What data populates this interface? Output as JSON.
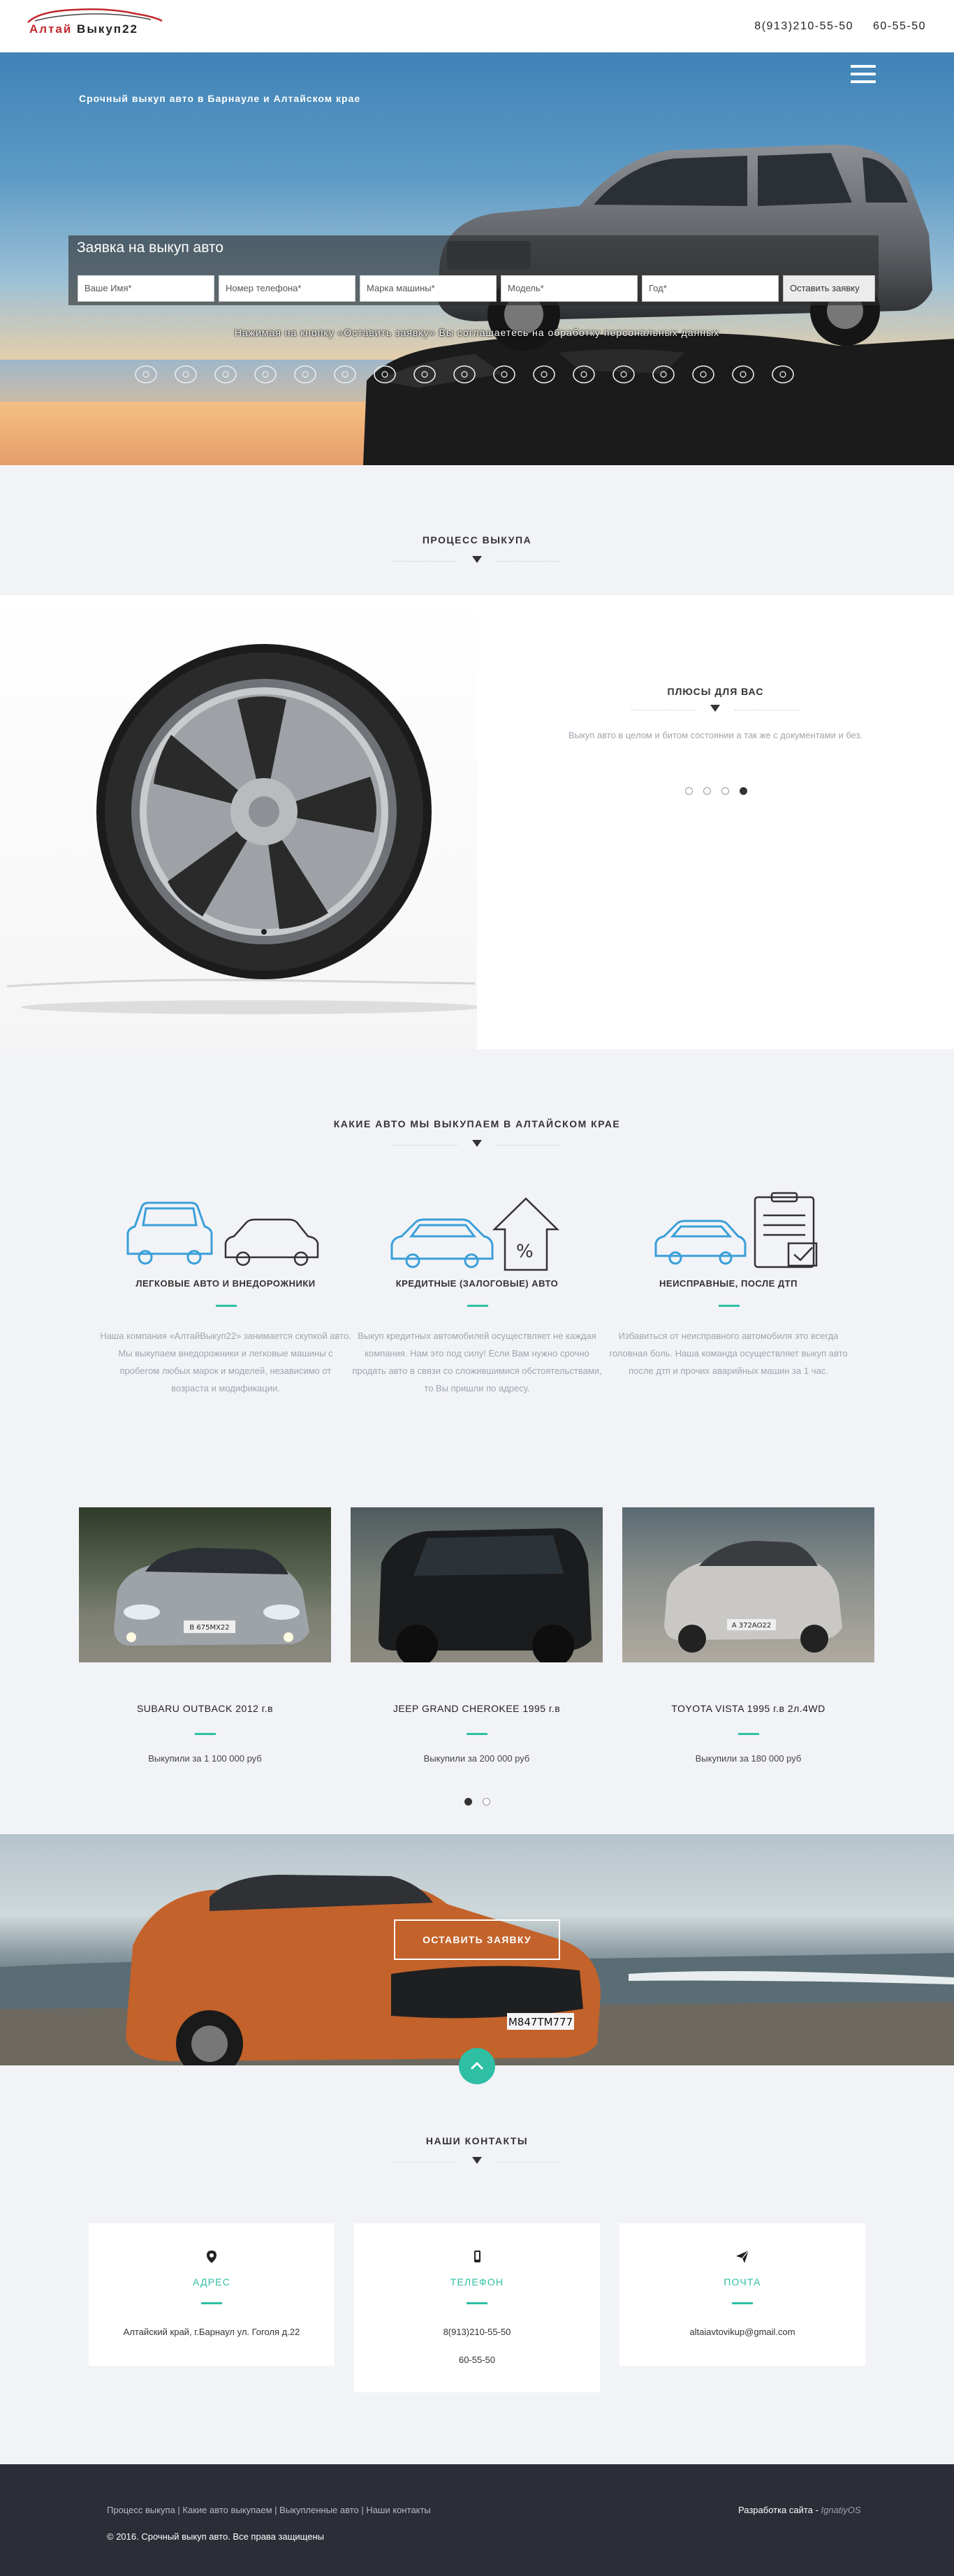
{
  "header": {
    "logo_part1": "Алтай",
    "logo_part2": "Выкуп22",
    "phone1": "8(913)210-55-50",
    "phone2": "60-55-50"
  },
  "hero": {
    "subtitle": "Срочный выкуп авто в Барнауле и Алтайском крае",
    "form_title": "Заявка на выкуп авто",
    "fields": [
      {
        "placeholder": "Ваше Имя*"
      },
      {
        "placeholder": "Номер телефона*"
      },
      {
        "placeholder": "Марка машины*"
      },
      {
        "placeholder": "Модель*"
      },
      {
        "placeholder": "Год*"
      }
    ],
    "submit_label": "Оставить заявку",
    "consent": "Нажимая на кнопку «Оставить заявку» Вы соглашаетесь на обработку персональных данных",
    "brands": [
      "mercedes-logo-icon",
      "chevrolet-logo-icon",
      "renault-logo-icon",
      "bmw-logo-icon",
      "audi-logo-icon",
      "opel-logo-icon",
      "ford-logo-icon",
      "skoda-logo-icon",
      "volkswagen-logo-icon",
      "nissan-logo-icon",
      "kia-logo-icon",
      "peugeot-logo-icon",
      "lexus-logo-icon",
      "hyundai-logo-icon",
      "citroen-logo-icon",
      "toyota-logo-icon",
      "mazda-logo-icon"
    ]
  },
  "process": {
    "title": "ПРОЦЕСС ВЫКУПА",
    "plus_title": "ПЛЮСЫ ДЛЯ ВАС",
    "plus_text": "Выкуп авто в целом и битом состоянии а так же с документами и без.",
    "slider_active": 4,
    "slider_count": 4
  },
  "types": {
    "title": "КАКИЕ АВТО МЫ ВЫКУПАЕМ В АЛТАЙСКОМ КРАЕ",
    "items": [
      {
        "heading": "ЛЕГКОВЫЕ АВТО И ВНЕДОРОЖНИКИ",
        "text": "Наша компания «АлтайВыкуп22» занимается скупкой авто. Мы выкупаем внедорожники и легковые машины с пробегом любых марок и моделей, независимо от возраста и модификации."
      },
      {
        "heading": "КРЕДИТНЫЕ (ЗАЛОГОВЫЕ) АВТО",
        "text": "Выкуп кредитных автомобилей осуществляет не каждая компания. Нам это под силу! Если Вам нужно срочно продать авто в связи со сложившимися обстоятельствами, то Вы пришли по адресу."
      },
      {
        "heading": "НЕИСПРАВНЫЕ, ПОСЛЕ ДТП",
        "text": "Избавиться от неисправного автомобиля это всегда головная боль. Наша команда осуществляет выкуп авто после дтп и прочих аварийных машин за 1 час."
      }
    ]
  },
  "cases": {
    "items": [
      {
        "title": "SUBARU OUTBACK 2012 г.в",
        "price": "Выкупили за 1 100 000 руб",
        "plate": "В 675МХ22"
      },
      {
        "title": "JEEP GRAND CHEROKEE 1995 г.в",
        "price": "Выкупили за 200 000 руб"
      },
      {
        "title": "TOYOTA VISTA 1995 г.в 2л.4WD",
        "price": "Выкупили за 180 000 руб",
        "plate": "А 372АО22"
      }
    ],
    "slider_active": 1,
    "slider_count": 2
  },
  "banner": {
    "cta_label": "ОСТАВИТЬ ЗАЯВКУ",
    "plate": "М847ТМ777"
  },
  "contacts": {
    "title": "НАШИ КОНТАКТЫ",
    "address_heading": "АДРЕС",
    "address": "Алтайский край, г.Барнаул ул. Гоголя д.22",
    "phone_heading": "ТЕЛЕФОН",
    "phone1": "8(913)210-55-50",
    "phone2": "60-55-50",
    "mail_heading": "ПОЧТА",
    "email": "altaiavtovikup@gmail.com"
  },
  "footer": {
    "nav": [
      "Процесс выкупа",
      "Какие авто выкупаем",
      "Выкупленные авто",
      "Наши контакты"
    ],
    "copyright": "© 2016. Срочный выкуп авто. Все права защищены",
    "dev_label": "Разработка сайта -",
    "dev_name": "IgnatiyOS"
  },
  "colors": {
    "accent": "#2ebfa5",
    "logo_red": "#c0272d",
    "footer_bg": "#2b2e37",
    "icon_blue": "#3a9fd8"
  }
}
